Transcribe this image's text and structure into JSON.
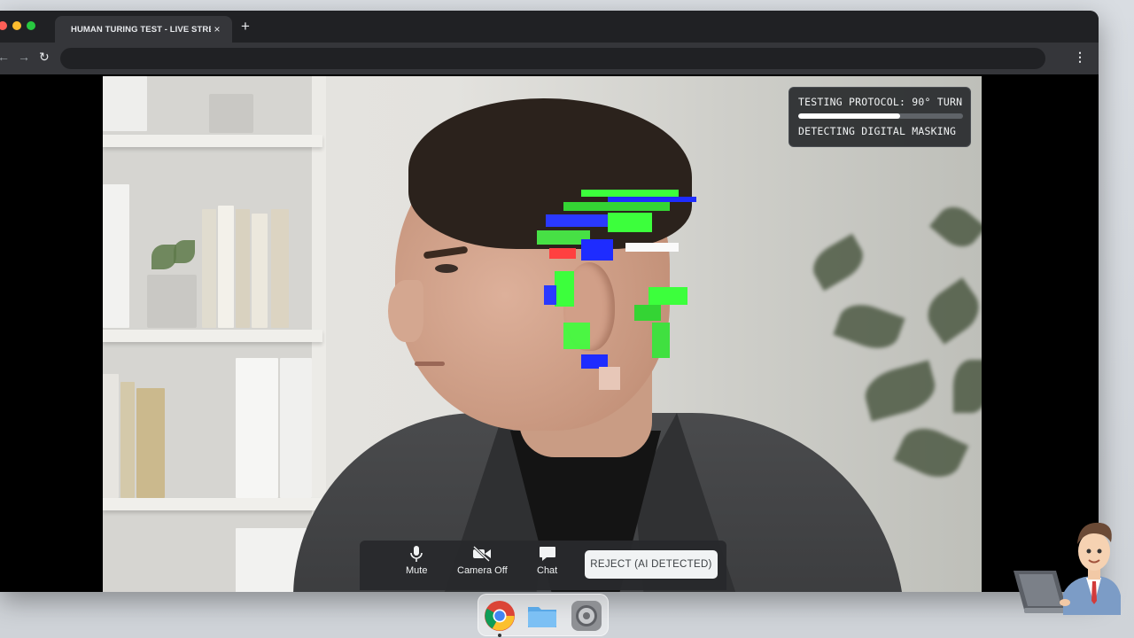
{
  "browser": {
    "tab_title": "HUMAN TURING TEST - LIVE STREAM",
    "tab_close": "×",
    "new_tab": "+",
    "url": ""
  },
  "hud": {
    "protocol_label": "TESTING PROTOCOL: 90° TURN",
    "progress": 0.62,
    "status_label": "DETECTING DIGITAL MASKING"
  },
  "controls": {
    "mute_label": "Mute",
    "camera_label": "Camera Off",
    "chat_label": "Chat",
    "reject_label": "REJECT (AI DETECTED)"
  },
  "icons": {
    "mute": "microphone-icon",
    "camera": "camera-off-icon",
    "chat": "chat-bubble-icon"
  },
  "dock": {
    "items": [
      "chrome",
      "files",
      "settings"
    ],
    "active": "chrome"
  },
  "colors": {
    "hud_bg": "#282a2d",
    "reject_bg": "#f1f3f4",
    "glitch_green": "#3cff3c",
    "glitch_blue": "#1e2cff"
  }
}
